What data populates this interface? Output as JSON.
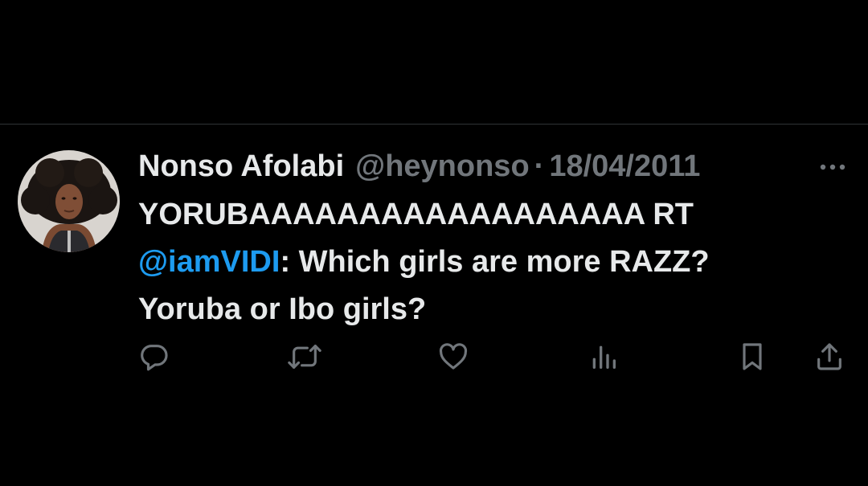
{
  "tweet": {
    "author_name": "Nonso Afolabi",
    "handle": "@heynonso",
    "separator": "·",
    "date": "18/04/2011",
    "text_line1": "YORUBAAAAAAAAAAAAAAAAAA RT",
    "mention": "@iamVIDI",
    "text_line2_rest": ": Which girls are more RAZZ?",
    "text_line3": "Yoruba or Ibo girls?"
  },
  "icons": {
    "more": "more-horizontal-icon",
    "reply": "reply-icon",
    "retweet": "retweet-icon",
    "like": "heart-icon",
    "views": "views-chart-icon",
    "bookmark": "bookmark-icon",
    "share": "share-icon"
  },
  "colors": {
    "background": "#000000",
    "text_primary": "#e7e9ea",
    "text_secondary": "#71767b",
    "link": "#1d9bf0",
    "divider": "#2f3336"
  }
}
